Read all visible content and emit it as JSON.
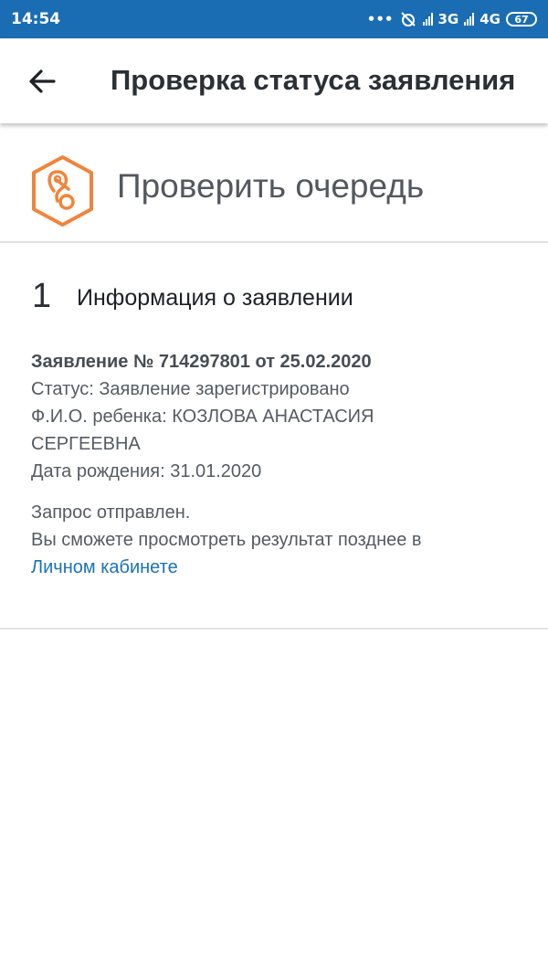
{
  "status_bar": {
    "time": "14:54",
    "dots": "•••",
    "net1": "3G",
    "net2": "4G",
    "battery": "67"
  },
  "app_bar": {
    "title": "Проверка статуса заявления",
    "back_icon": "arrow-left-icon"
  },
  "queue_section": {
    "logo_icon": "pacifier-icon",
    "title": "Проверить очередь"
  },
  "step": {
    "number": "1",
    "title": "Информация о заявлении"
  },
  "application": {
    "header": "Заявление № 714297801 от 25.02.2020",
    "status": "Статус: Заявление зарегистрировано",
    "child_line1": "Ф.И.О. ребенка: КОЗЛОВА АНАСТАСИЯ",
    "child_line2": "СЕРГЕЕВНА",
    "birth_date": "Дата рождения: 31.01.2020"
  },
  "notice": {
    "sent": "Запрос отправлен.",
    "later": "Вы сможете просмотреть результат позднее в",
    "link": "Личном кабинете"
  },
  "colors": {
    "status_bar": "#1b6db3",
    "accent_orange": "#f0843c",
    "link": "#1a73b5"
  }
}
